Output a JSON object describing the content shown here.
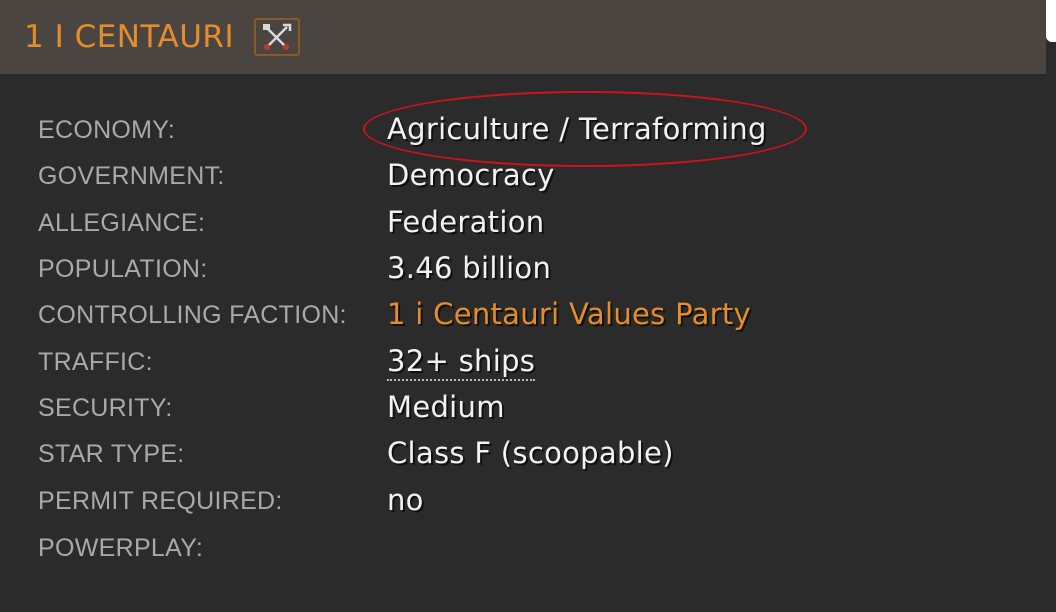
{
  "header": {
    "title": "1 I CENTAURI",
    "tools_icon": "crossed-tools-icon"
  },
  "rows": [
    {
      "label": "ECONOMY:",
      "value": "Agriculture / Terraforming"
    },
    {
      "label": "GOVERNMENT:",
      "value": "Democracy"
    },
    {
      "label": "ALLEGIANCE:",
      "value": "Federation"
    },
    {
      "label": "POPULATION:",
      "value": "3.46 billion"
    },
    {
      "label": "CONTROLLING FACTION:",
      "value": "1 i Centauri Values Party"
    },
    {
      "label": "TRAFFIC:",
      "value": "32+ ships"
    },
    {
      "label": "SECURITY:",
      "value": "Medium"
    },
    {
      "label": "STAR TYPE:",
      "value": "Class F (scoopable)"
    },
    {
      "label": "PERMIT REQUIRED:",
      "value": "no"
    },
    {
      "label": "POWERPLAY:",
      "value": ""
    }
  ],
  "colors": {
    "accent": "#e58d2a",
    "header_bg": "#4a4540",
    "panel_bg": "#2b2b2b",
    "highlight_circle": "#d1121c"
  }
}
